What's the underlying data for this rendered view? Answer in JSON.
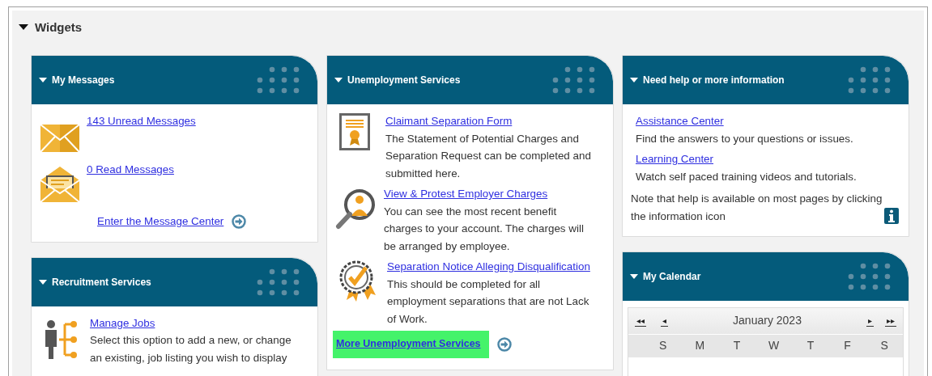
{
  "section": {
    "title": "Widgets",
    "expanded": true
  },
  "columns": [
    [
      {
        "kind": "links",
        "title": "My Messages",
        "expanded": true,
        "items": [
          {
            "link": "143 Unread Messages"
          },
          {
            "link": "0 Read Messages"
          }
        ],
        "footer": {
          "link": "Enter the Message Center",
          "highlighted": false
        }
      },
      {
        "kind": "links",
        "title": "Recruitment Services",
        "expanded": true,
        "items": [
          {
            "link": "Manage Jobs",
            "text": "Select this option to add a new, or change an existing, job listing you wish to display"
          }
        ]
      }
    ],
    [
      {
        "kind": "links",
        "title": "Unemployment Services",
        "expanded": true,
        "items": [
          {
            "link": "Claimant Separation Form",
            "text": "The Statement of Potential Charges and Separation Request can be completed and submitted here."
          },
          {
            "link": "View & Protest Employer Charges",
            "text": "You can see the most recent benefit charges to your account. The charges will be arranged by employee."
          },
          {
            "link": "Separation Notice Alleging Disqualification",
            "text": "This should be completed for all employment separations that are not Lack of Work."
          }
        ],
        "footer": {
          "link": "More Unemployment Services",
          "highlighted": true
        }
      }
    ],
    [
      {
        "kind": "links",
        "title": "Need help or more information",
        "expanded": true,
        "items": [
          {
            "link": "Assistance Center",
            "text": "Find the answers to your questions or issues."
          },
          {
            "link": "Learning Center",
            "text": "Watch self paced training videos and tutorials."
          }
        ],
        "note": "Note that help is available on most pages by clicking the information icon"
      },
      {
        "kind": "calendar",
        "title": "My Calendar",
        "expanded": true,
        "month": "January 2023",
        "nav": [
          "◂◂",
          "◂",
          "▸",
          "▸▸"
        ],
        "weekdays": [
          "S",
          "M",
          "T",
          "W",
          "T",
          "F",
          "S"
        ]
      }
    ]
  ]
}
